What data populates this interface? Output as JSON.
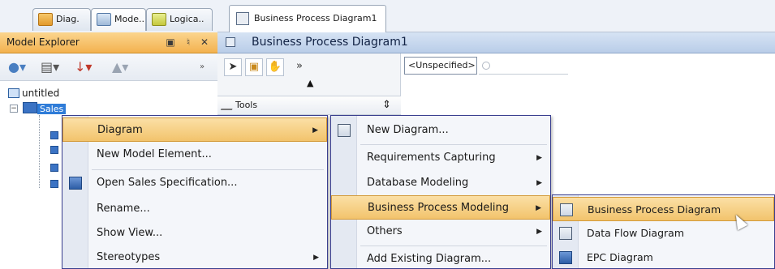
{
  "tabs": [
    {
      "label": "Diag."
    },
    {
      "label": "Mode.."
    },
    {
      "label": "Logica.."
    }
  ],
  "explorer": {
    "title": "Model Explorer",
    "controls": [
      "restore-icon",
      "pin-icon",
      "close-icon"
    ],
    "toolbar_icons": [
      "new-model-icon",
      "project-dropdown-icon",
      "sort-icon",
      "up-icon"
    ],
    "tree": {
      "root": "untitled",
      "selected": "Sales"
    }
  },
  "editor": {
    "tab_label": "Business Process Diagram1",
    "title": "Business Process Diagram1",
    "palette_tools_label": "Tools",
    "unspecified": "<Unspecified>"
  },
  "menu1": {
    "items": [
      {
        "label": "Diagram",
        "submenu": true,
        "highlighted": true,
        "icon": ""
      },
      {
        "label": "New Model Element...",
        "submenu": false,
        "highlighted": false,
        "icon": ""
      },
      {
        "label": "Open Sales Specification...",
        "submenu": false,
        "highlighted": false,
        "icon": "specification-icon"
      },
      {
        "label": "Rename...",
        "submenu": false,
        "highlighted": false,
        "icon": ""
      },
      {
        "label": "Show View...",
        "submenu": false,
        "highlighted": false,
        "icon": ""
      },
      {
        "label": "Stereotypes",
        "submenu": true,
        "highlighted": false,
        "icon": ""
      }
    ]
  },
  "menu2": {
    "items": [
      {
        "label": "New Diagram...",
        "submenu": false,
        "highlighted": false,
        "icon": "new-diagram-icon"
      },
      {
        "label": "Requirements Capturing",
        "submenu": true,
        "highlighted": false
      },
      {
        "label": "Database Modeling",
        "submenu": true,
        "highlighted": false
      },
      {
        "label": "Business Process Modeling",
        "submenu": true,
        "highlighted": true
      },
      {
        "label": "Others",
        "submenu": true,
        "highlighted": false
      },
      {
        "label": "Add Existing Diagram...",
        "submenu": false,
        "highlighted": false
      }
    ]
  },
  "menu3": {
    "items": [
      {
        "label": "Business Process Diagram",
        "highlighted": true,
        "icon": "bpd-icon"
      },
      {
        "label": "Data Flow Diagram",
        "highlighted": false,
        "icon": "dfd-icon"
      },
      {
        "label": "EPC Diagram",
        "highlighted": false,
        "icon": "epc-icon"
      }
    ]
  },
  "colors": {
    "highlight": "#f2c36c",
    "menu_border": "#3a3f8f",
    "explorer_header": "#f3b24f",
    "editor_header": "#b9cde8"
  }
}
